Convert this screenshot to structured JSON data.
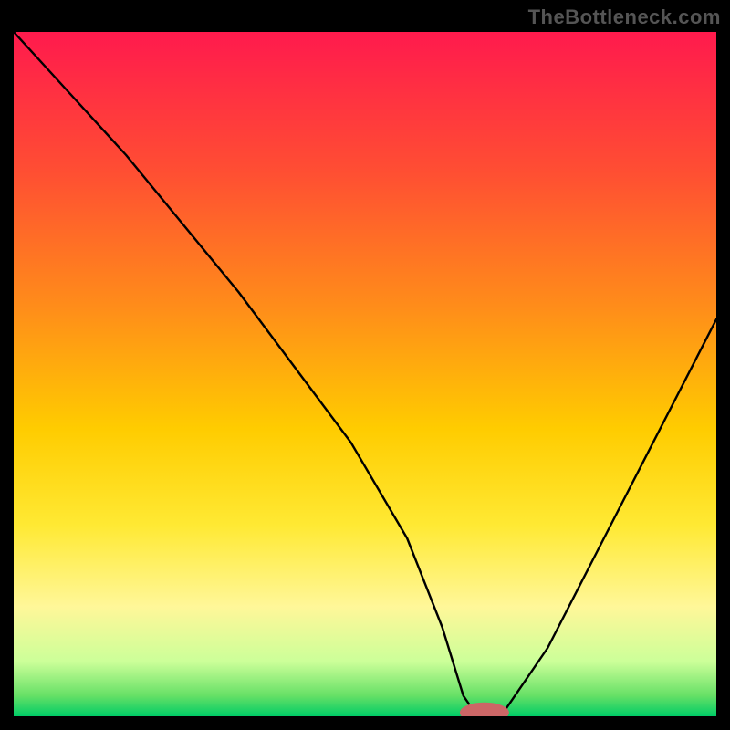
{
  "watermark": "TheBottleneck.com",
  "chart_data": {
    "type": "line",
    "title": "",
    "xlabel": "",
    "ylabel": "",
    "xlim": [
      0,
      100
    ],
    "ylim": [
      0,
      100
    ],
    "grid": false,
    "series": [
      {
        "name": "bottleneck-curve",
        "x": [
          0,
          8,
          16,
          24,
          32,
          40,
          48,
          56,
          61,
          64,
          66,
          68,
          70,
          76,
          82,
          88,
          94,
          100
        ],
        "values": [
          100,
          91,
          82,
          72,
          62,
          51,
          40,
          26,
          13,
          3,
          0,
          0,
          1,
          10,
          22,
          34,
          46,
          58
        ]
      }
    ],
    "marker": {
      "x": 67,
      "y": 0,
      "rx": 3.5,
      "ry": 1.5,
      "color": "#cc6666"
    },
    "gradient_stops": [
      {
        "offset": 0.0,
        "color": "#ff1a4d"
      },
      {
        "offset": 0.2,
        "color": "#ff4d33"
      },
      {
        "offset": 0.4,
        "color": "#ff8c1a"
      },
      {
        "offset": 0.58,
        "color": "#ffcc00"
      },
      {
        "offset": 0.72,
        "color": "#ffe933"
      },
      {
        "offset": 0.84,
        "color": "#fff799"
      },
      {
        "offset": 0.92,
        "color": "#ccff99"
      },
      {
        "offset": 0.97,
        "color": "#66e066"
      },
      {
        "offset": 1.0,
        "color": "#00cc66"
      }
    ]
  }
}
